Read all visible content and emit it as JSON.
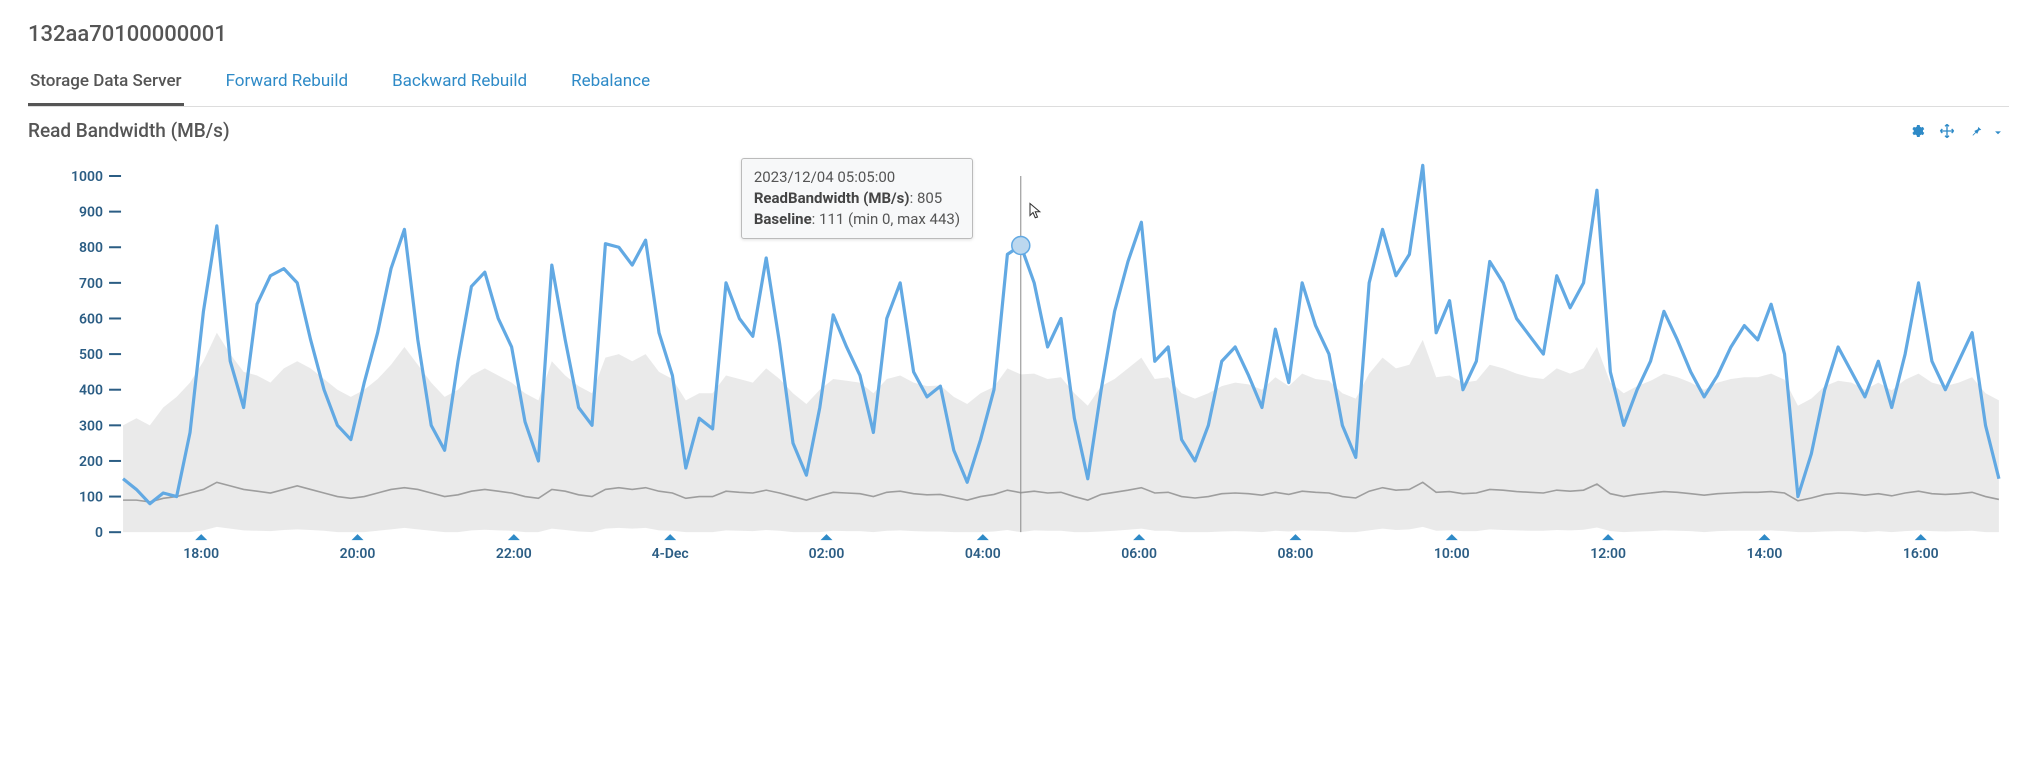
{
  "page_title": "132aa70100000001",
  "tabs": [
    {
      "label": "Storage Data Server",
      "active": true
    },
    {
      "label": "Forward Rebuild",
      "active": false
    },
    {
      "label": "Backward Rebuild",
      "active": false
    },
    {
      "label": "Rebalance",
      "active": false
    }
  ],
  "chart_title": "Read Bandwidth (MB/s)",
  "toolbar": {
    "settings_icon": "settings",
    "move_icon": "move",
    "pin_icon": "pin",
    "menu_icon": "menu"
  },
  "tooltip": {
    "time": "2023/12/04 05:05:00",
    "metric_label": "ReadBandwidth (MB/s)",
    "metric_value": "805",
    "baseline_label": "Baseline",
    "baseline_value": "111 (min 0, max 443)"
  },
  "chart_data": {
    "type": "line",
    "title": "Read Bandwidth (MB/s)",
    "xlabel": "",
    "ylabel": "",
    "y_ticks": [
      0,
      100,
      200,
      300,
      400,
      500,
      600,
      700,
      800,
      900,
      1000
    ],
    "ylim": [
      0,
      1000
    ],
    "x_labels": [
      "18:00",
      "20:00",
      "22:00",
      "4-Dec",
      "02:00",
      "04:00",
      "06:00",
      "08:00",
      "10:00",
      "12:00",
      "14:00",
      "16:00"
    ],
    "hover": {
      "x_index": 67,
      "value": 805,
      "baseline": 111,
      "baseline_min": 0,
      "baseline_max": 443
    },
    "series": [
      {
        "name": "ReadBandwidth (MB/s)",
        "color": "#62a9e3",
        "values": [
          150,
          120,
          80,
          110,
          100,
          280,
          620,
          860,
          480,
          350,
          640,
          720,
          740,
          700,
          540,
          400,
          300,
          260,
          420,
          560,
          740,
          850,
          540,
          300,
          230,
          480,
          690,
          730,
          600,
          520,
          310,
          200,
          750,
          540,
          350,
          300,
          810,
          800,
          750,
          820,
          560,
          440,
          180,
          320,
          290,
          700,
          600,
          550,
          770,
          530,
          250,
          160,
          350,
          610,
          520,
          440,
          280,
          600,
          700,
          450,
          380,
          410,
          230,
          140,
          260,
          400,
          780,
          805,
          700,
          520,
          600,
          320,
          150,
          400,
          620,
          760,
          870,
          480,
          520,
          260,
          200,
          300,
          480,
          520,
          440,
          350,
          570,
          420,
          700,
          580,
          500,
          300,
          210,
          700,
          850,
          720,
          780,
          1030,
          560,
          650,
          400,
          480,
          760,
          700,
          600,
          550,
          500,
          720,
          630,
          700,
          960,
          450,
          300,
          400,
          480,
          620,
          540,
          450,
          380,
          440,
          520,
          580,
          540,
          640,
          500,
          100,
          220,
          400,
          520,
          450,
          380,
          480,
          350,
          500,
          700,
          480,
          400,
          480,
          560,
          300,
          150
        ]
      },
      {
        "name": "Baseline",
        "color": "#9e9e9e",
        "values": [
          90,
          90,
          85,
          95,
          100,
          110,
          120,
          140,
          130,
          120,
          115,
          110,
          120,
          130,
          120,
          110,
          100,
          95,
          100,
          110,
          120,
          125,
          120,
          110,
          100,
          105,
          115,
          120,
          115,
          110,
          100,
          95,
          120,
          115,
          105,
          100,
          120,
          125,
          120,
          125,
          115,
          110,
          95,
          100,
          100,
          115,
          112,
          110,
          118,
          110,
          100,
          90,
          102,
          112,
          110,
          108,
          100,
          112,
          115,
          108,
          105,
          106,
          98,
          90,
          100,
          106,
          118,
          111,
          115,
          110,
          112,
          100,
          90,
          106,
          112,
          118,
          125,
          110,
          112,
          100,
          96,
          100,
          108,
          110,
          108,
          104,
          112,
          106,
          115,
          112,
          110,
          100,
          96,
          115,
          125,
          118,
          120,
          140,
          112,
          114,
          108,
          110,
          120,
          118,
          114,
          112,
          110,
          118,
          115,
          118,
          135,
          108,
          100,
          106,
          110,
          114,
          112,
          108,
          104,
          108,
          110,
          112,
          112,
          114,
          110,
          88,
          96,
          106,
          110,
          108,
          104,
          108,
          102,
          110,
          115,
          108,
          106,
          108,
          112,
          100,
          92
        ]
      },
      {
        "name": "Baseline max",
        "role": "band-upper",
        "values": [
          300,
          320,
          300,
          350,
          380,
          420,
          480,
          560,
          500,
          450,
          440,
          420,
          460,
          480,
          460,
          430,
          400,
          380,
          400,
          430,
          470,
          520,
          470,
          420,
          380,
          400,
          440,
          460,
          440,
          420,
          390,
          370,
          480,
          440,
          410,
          390,
          490,
          500,
          480,
          500,
          450,
          430,
          370,
          390,
          390,
          440,
          430,
          420,
          460,
          430,
          390,
          360,
          400,
          430,
          425,
          420,
          390,
          430,
          440,
          420,
          410,
          412,
          380,
          360,
          390,
          408,
          460,
          443,
          445,
          430,
          435,
          390,
          355,
          410,
          430,
          460,
          490,
          430,
          435,
          390,
          375,
          390,
          410,
          420,
          415,
          400,
          435,
          410,
          445,
          430,
          425,
          390,
          375,
          445,
          490,
          460,
          470,
          540,
          435,
          440,
          420,
          425,
          470,
          460,
          445,
          435,
          430,
          460,
          445,
          460,
          520,
          420,
          390,
          410,
          425,
          445,
          435,
          420,
          400,
          420,
          430,
          435,
          435,
          445,
          428,
          355,
          375,
          410,
          425,
          420,
          400,
          420,
          398,
          428,
          445,
          420,
          410,
          420,
          435,
          390,
          370
        ]
      },
      {
        "name": "Baseline min",
        "role": "band-lower",
        "values": [
          0,
          0,
          0,
          0,
          0,
          0,
          5,
          15,
          10,
          5,
          4,
          3,
          6,
          8,
          6,
          4,
          0,
          0,
          0,
          4,
          8,
          12,
          8,
          4,
          0,
          0,
          5,
          7,
          5,
          4,
          0,
          0,
          10,
          6,
          2,
          0,
          10,
          12,
          10,
          12,
          5,
          4,
          0,
          0,
          0,
          5,
          4,
          3,
          6,
          4,
          0,
          0,
          0,
          4,
          3,
          3,
          0,
          4,
          5,
          3,
          2,
          2,
          0,
          0,
          0,
          2,
          6,
          0,
          5,
          4,
          4,
          0,
          0,
          2,
          4,
          7,
          10,
          4,
          4,
          0,
          0,
          0,
          2,
          3,
          2,
          0,
          4,
          2,
          5,
          4,
          3,
          0,
          0,
          5,
          10,
          6,
          8,
          15,
          4,
          5,
          3,
          3,
          8,
          6,
          5,
          4,
          4,
          6,
          5,
          7,
          13,
          3,
          0,
          2,
          3,
          5,
          4,
          3,
          0,
          3,
          4,
          4,
          4,
          5,
          3,
          0,
          0,
          2,
          3,
          3,
          0,
          3,
          0,
          3,
          5,
          3,
          2,
          3,
          4,
          0,
          0
        ]
      }
    ]
  }
}
